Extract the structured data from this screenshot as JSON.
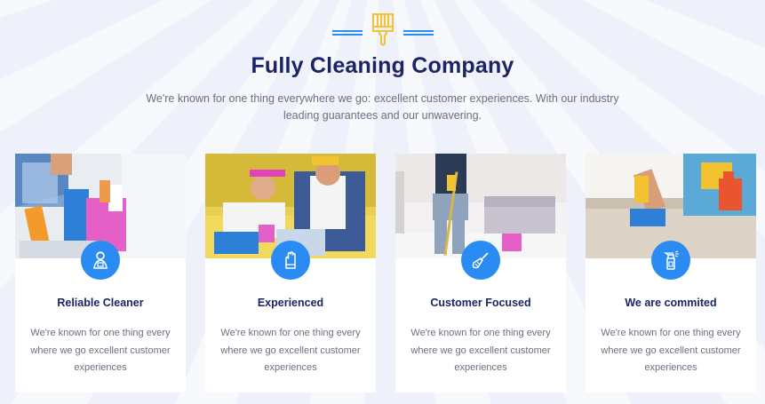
{
  "header": {
    "icon": "brush-icon",
    "title": "Fully Cleaning Company",
    "subtitle": "We're known for one thing everywhere we go: excellent customer experiences. With our industry leading guarantees and our unwavering."
  },
  "colors": {
    "accent": "#2a8bf2",
    "heading": "#1b2566",
    "brush": "#f2c230",
    "text": "#6b7080"
  },
  "cards": [
    {
      "icon": "cleaner-person-icon",
      "title": "Reliable Cleaner",
      "text": "We're known for one thing every where we go excellent customer experiences"
    },
    {
      "icon": "glove-hand-icon",
      "title": "Experienced",
      "text": "We're known for one thing every where we go excellent customer experiences"
    },
    {
      "icon": "broom-icon",
      "title": "Customer Focused",
      "text": "We're known for one thing every where we go excellent customer experiences"
    },
    {
      "icon": "spray-bottle-icon",
      "title": "We are commited",
      "text": "We're known for one thing every where we go excellent customer experiences"
    }
  ]
}
